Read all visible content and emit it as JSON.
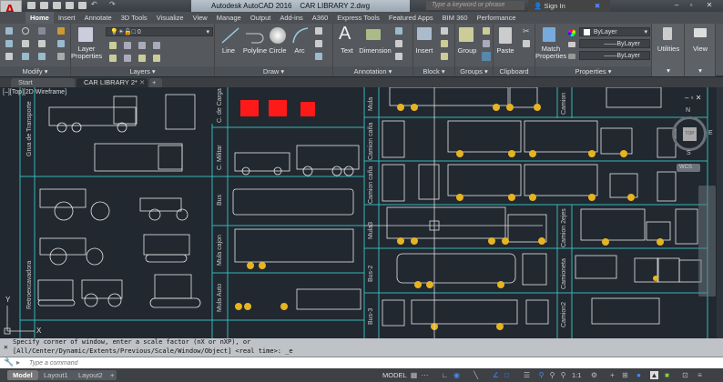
{
  "title_bar": {
    "app_title": "Autodesk AutoCAD 2016",
    "file_name": "CAR LIBRARY 2.dwg",
    "search_placeholder": "Type a keyword or phrase",
    "sign_in": "Sign In",
    "minimize": "–",
    "restore": "▫",
    "close": "✕",
    "app_button": "A"
  },
  "ribbon_tabs": [
    "Home",
    "Insert",
    "Annotate",
    "3D Tools",
    "Visualize",
    "View",
    "Manage",
    "Output",
    "Add-ins",
    "A360",
    "Express Tools",
    "Featured Apps",
    "BIM 360",
    "Performance"
  ],
  "ribbon": {
    "modify": {
      "title": "Modify"
    },
    "layers": {
      "title": "Layers",
      "layer_properties": "Layer Properties",
      "current_layer": "0"
    },
    "draw": {
      "title": "Draw",
      "line": "Line",
      "polyline": "Polyline",
      "circle": "Circle",
      "arc": "Arc"
    },
    "annotation": {
      "title": "Annotation",
      "text": "Text",
      "dimension": "Dimension"
    },
    "block": {
      "title": "Block",
      "insert": "Insert"
    },
    "groups": {
      "title": "Groups",
      "group": "Group"
    },
    "clipboard": {
      "title": "Clipboard",
      "paste": "Paste"
    },
    "properties": {
      "title": "Properties",
      "match_properties": "Match Properties",
      "color": "ByLayer",
      "linetype": "ByLayer",
      "lineweight": "ByLayer"
    },
    "utilities": {
      "title": "Utilities"
    },
    "view": {
      "title": "View"
    }
  },
  "doc_tabs": {
    "start": "Start",
    "active": "CAR LIBRARY 2*",
    "add": "+"
  },
  "viewport": {
    "label": "[–][Top][2D Wireframe]",
    "compass": {
      "n": "N",
      "e": "E",
      "s": "S",
      "top": "TOP"
    },
    "wcs": "WCS",
    "ucs": {
      "x": "X",
      "y": "Y"
    },
    "block_labels": [
      "Grua de Transporte",
      "Retroexcavadora",
      "C. de Carga",
      "C. Militar",
      "Bus",
      "Mula cajon",
      "Mula Auto",
      "Mula",
      "Camion caña",
      "Camion caña",
      "Mula3",
      "Bus-2",
      "Bus-3",
      "Camion",
      "Camion 2ejes",
      "Camioneta",
      "Camion2"
    ]
  },
  "colors": {
    "grid": "#35b6b8",
    "lines": "#e8e8e8",
    "accent": "#e6b422",
    "red": "#ff1a1a",
    "background": "#212830"
  },
  "command": {
    "history": [
      "Specify corner of window, enter a scale factor (nX or nXP), or",
      "[All/Center/Dynamic/Extents/Previous/Scale/Window/Object] <real time>: _e"
    ],
    "placeholder": "Type a command"
  },
  "status_bar": {
    "layouts": [
      "Model",
      "Layout1",
      "Layout2"
    ],
    "add": "+",
    "mode": "MODEL",
    "scale": "1:1"
  }
}
